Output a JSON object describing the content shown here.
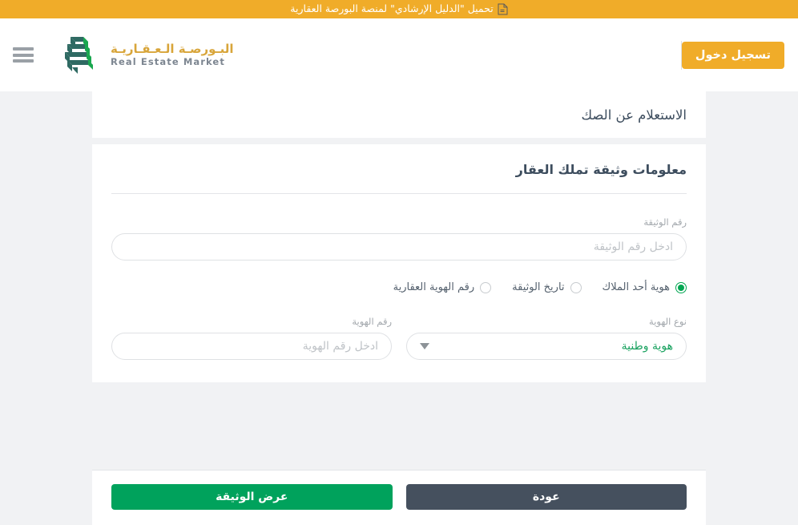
{
  "banner": {
    "text": "تحميل \"الدليل الإرشادي\" لمنصة البورصة العقارية",
    "icon": "document-download-icon",
    "background": "#f0ac29"
  },
  "header": {
    "brand_ar": "البـورصـة الـعـقـاريـة",
    "brand_en": "Real Estate Market",
    "brand_ar_color": "#d8a53a",
    "brand_en_color": "#7d8691",
    "logo_icon": "saudi-map-layers-logo",
    "menu_icon": "hamburger-menu-icon",
    "login_label": "تسجيل دخول",
    "login_color": "#f0ac29"
  },
  "page": {
    "title": "الاستعلام عن الصك",
    "section_title": "معلومات وثيقة تملك العقار"
  },
  "form": {
    "document_number": {
      "label": "رقم الوثيقة",
      "placeholder": "ادخل رقم الوثيقة",
      "value": ""
    },
    "search_by": {
      "options": [
        {
          "label": "هوية أحد الملاك",
          "selected": true
        },
        {
          "label": "تاريخ الوثيقة",
          "selected": false
        },
        {
          "label": "رقم الهوية العقارية",
          "selected": false
        }
      ],
      "selected_color": "#00a651"
    },
    "id_type": {
      "label": "نوع الهوية",
      "value": "هوية وطنية",
      "value_color": "#1aa260",
      "caret_icon": "chevron-down-icon"
    },
    "id_number": {
      "label": "رقم الهوية",
      "placeholder": "ادخل رقم الهوية",
      "value": ""
    }
  },
  "actions": {
    "back_label": "عودة",
    "back_color": "#45505e",
    "view_label": "عرض الوثيقة",
    "view_color": "#00a25c"
  }
}
